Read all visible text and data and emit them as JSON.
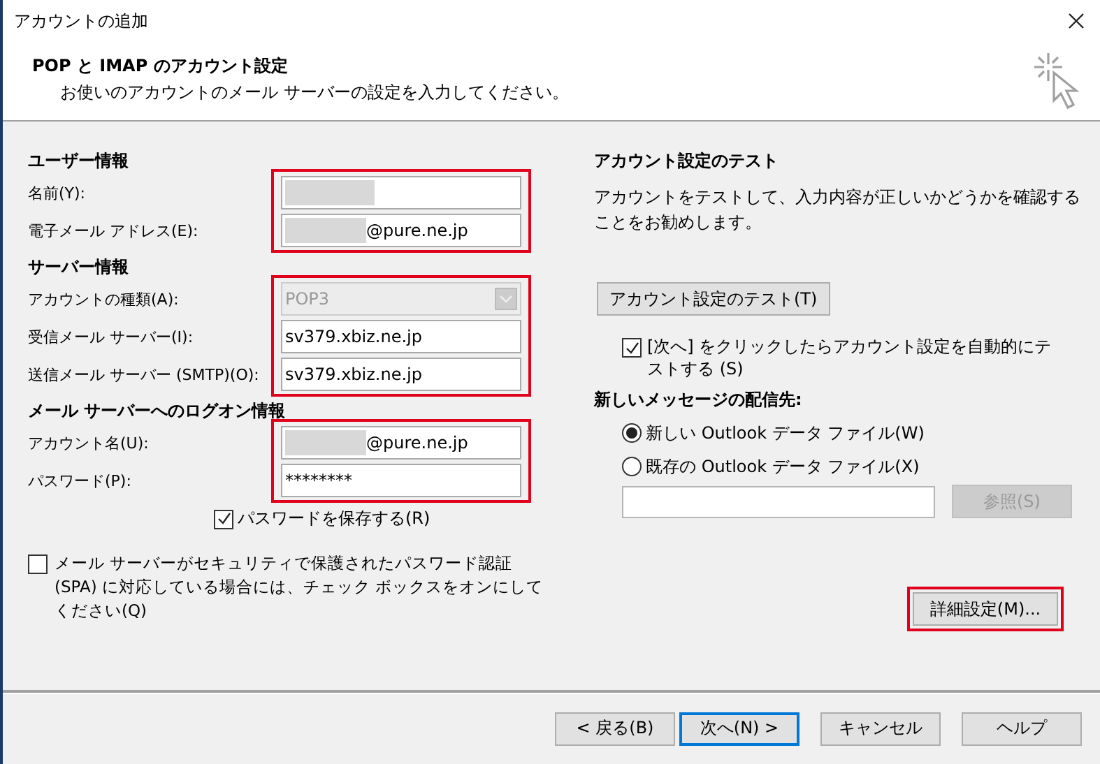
{
  "window": {
    "title": "アカウントの追加"
  },
  "header": {
    "title": "POP と IMAP のアカウント設定",
    "subtitle": "お使いのアカウントのメール サーバーの設定を入力してください。"
  },
  "sections": [
    {
      "heading": "ユーザー情報",
      "highlighted": true,
      "fields": [
        {
          "kind": "text",
          "label": "名前(Y):",
          "redacted": true
        },
        {
          "kind": "text",
          "label": "電子メール アドレス(E):",
          "redacted": true,
          "value": "@pure.ne.jp"
        }
      ]
    },
    {
      "heading": "サーバー情報",
      "highlighted": true,
      "fields": [
        {
          "kind": "dropdown",
          "label": "アカウントの種類(A):",
          "value": "POP3",
          "disabled": true
        },
        {
          "kind": "text",
          "label": "受信メール サーバー(I):",
          "value": "sv379.xbiz.ne.jp",
          "redacted": false
        },
        {
          "kind": "text",
          "label": "送信メール サーバー (SMTP)(O):",
          "value": "sv379.xbiz.ne.jp",
          "redacted": false
        }
      ]
    },
    {
      "heading": "メール サーバーへのログオン情報",
      "highlighted": true,
      "fields": [
        {
          "kind": "text",
          "label": "アカウント名(U):",
          "redacted": true,
          "value": "@pure.ne.jp"
        },
        {
          "kind": "text",
          "label": "パスワード(P):",
          "value": "********",
          "redacted": false
        }
      ]
    }
  ],
  "save_password": {
    "label": "パスワードを保存する(R)",
    "checked": true
  },
  "spa": {
    "label": "メール サーバーがセキュリティで保護されたパスワード認証 (SPA) に対応している場合には、チェック ボックスをオンにしてください(Q)",
    "checked": false
  },
  "test": {
    "heading": "アカウント設定のテスト",
    "description": "アカウントをテストして、入力内容が正しいかどうかを確認することをお勧めします。",
    "button": "アカウント設定のテスト(T)",
    "auto_test": {
      "label": "[次へ] をクリックしたらアカウント設定を自動的にテストする (S)",
      "checked": true
    }
  },
  "delivery": {
    "heading": "新しいメッセージの配信先:",
    "options": [
      {
        "label": "新しい Outlook データ ファイル(W)",
        "selected": true
      },
      {
        "label": "既存の Outlook データ ファイル(X)",
        "selected": false
      }
    ],
    "browse": {
      "label": "参照(S)",
      "disabled": true
    }
  },
  "details_button": {
    "label": "詳細設定(M)...",
    "highlighted": true
  },
  "footer_buttons": [
    {
      "label": "< 戻る(B)",
      "default": false
    },
    {
      "label": "次へ(N) >",
      "default": true
    },
    {
      "label": "キャンセル",
      "default": false
    },
    {
      "label": "ヘルプ",
      "default": false
    }
  ]
}
